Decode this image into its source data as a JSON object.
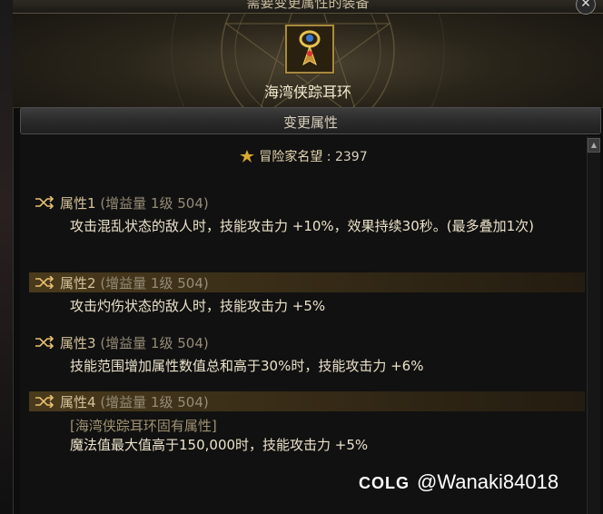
{
  "dialog": {
    "header_title": "需要变更属性的装备",
    "close_label": "✕"
  },
  "item": {
    "name": "海湾侠踪耳环",
    "icon": "earring-icon"
  },
  "section": {
    "title": "变更属性"
  },
  "fame": {
    "label": "冒险家名望 : ",
    "value": "2397",
    "icon": "fame-icon"
  },
  "attributes": [
    {
      "label": "属性1",
      "paren": " (增益量 1级 504)",
      "description": "攻击混乱状态的敌人时，技能攻击力 +10%，效果持续30秒。(最多叠加1次)",
      "highlighted": false
    },
    {
      "label": "属性2",
      "paren": " (增益量 1级 504)",
      "description": "攻击灼伤状态的敌人时，技能攻击力 +5%",
      "highlighted": true
    },
    {
      "label": "属性3",
      "paren": " (增益量 1级 504)",
      "description": "技能范围增加属性数值总和高于30%时，技能攻击力 +6%",
      "highlighted": false
    },
    {
      "label": "属性4",
      "paren": " (增益量 1级 504)",
      "sub_label": "[海湾侠踪耳环固有属性]",
      "description": "魔法值最大值高于150,000时，技能攻击力 +5%",
      "highlighted": true
    }
  ],
  "watermark": {
    "logo": "COLG",
    "handle": "@Wanaki84018"
  },
  "colors": {
    "accent_gold": "#d4c29a",
    "highlight_row": "#4a3a1c",
    "background": "#111111"
  }
}
